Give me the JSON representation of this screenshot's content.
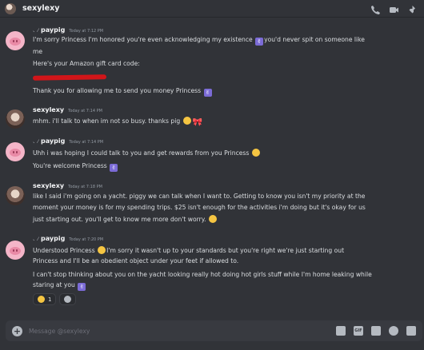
{
  "header": {
    "name": "sexylexy"
  },
  "messages": [
    {
      "author_prefix": "、⁄",
      "author": "paypig",
      "time": "Today at 7:12 PM",
      "lines": [
        "I'm sorry Princess I'm honored you're even acknowledging my existence",
        "you'd never spit on someone like",
        "me",
        "Here's your Amazon gift card code:",
        "Thank you for allowing me to send you money Princess"
      ]
    },
    {
      "author": "sexylexy",
      "time": "Today at 7:14 PM",
      "lines": [
        "mhm. i'll talk to when im not so busy. thanks pig"
      ]
    },
    {
      "author_prefix": "、⁄",
      "author": "paypig",
      "time": "Today at 7:14 PM",
      "lines": [
        "Uhh i was hoping I could talk to you and get rewards from you Princess",
        "You're welcome Princess"
      ]
    },
    {
      "author": "sexylexy",
      "time": "Today at 7:18 PM",
      "lines": [
        "like I said i'm going on a yacht. piggy we can talk when I want to.  Getting to know you isn't my priority at the",
        "moment your money is for my spending trips. $25 isn't enough for the activities i'm doing but it's okay for us",
        "just starting out. you'll get to know me more don't worry."
      ]
    },
    {
      "author_prefix": "、⁄",
      "author": "paypig",
      "time": "Today at 7:20 PM",
      "lines": [
        "Understood Princess",
        "I'm sorry it wasn't up to your standards but you're right we're just starting out",
        "Princess and I'll be an obedient object under your feet if allowed to.",
        "I can't stop thinking about you on the yacht looking really hot doing hot girls stuff while I'm home leaking while",
        "staring at you"
      ]
    }
  ],
  "reactions": [
    {
      "emoji": "grimace-face",
      "count": "1"
    }
  ],
  "composer": {
    "placeholder": "Message @sexylexy"
  }
}
